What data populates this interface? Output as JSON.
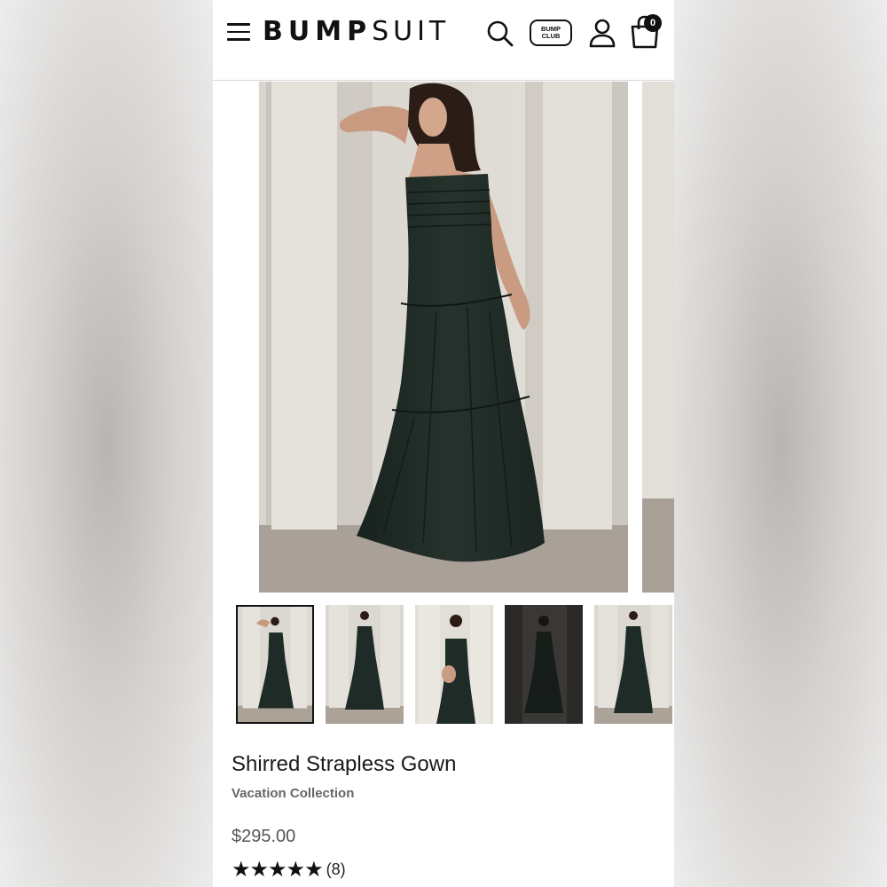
{
  "background": {
    "page_color": "#ffffff",
    "blur_color": "#c9c6c3"
  },
  "header": {
    "logo_bold": "BUMP",
    "logo_light": "SUIT",
    "bump_club_line1": "BUMP",
    "bump_club_line2": "CLUB",
    "cart_count": "0",
    "icons": [
      "menu-icon",
      "search-icon",
      "bump-club-icon",
      "user-icon",
      "shopping-bag-icon"
    ]
  },
  "gallery": {
    "thumbnail_count": 5,
    "selected_index": 0
  },
  "product": {
    "title": "Shirred Strapless Gown",
    "collection": "Vacation Collection",
    "price": "$295.00",
    "stars": "★★★★★",
    "rating_value": 5,
    "review_count": "(8)",
    "dress_color": "#1f2b26"
  }
}
